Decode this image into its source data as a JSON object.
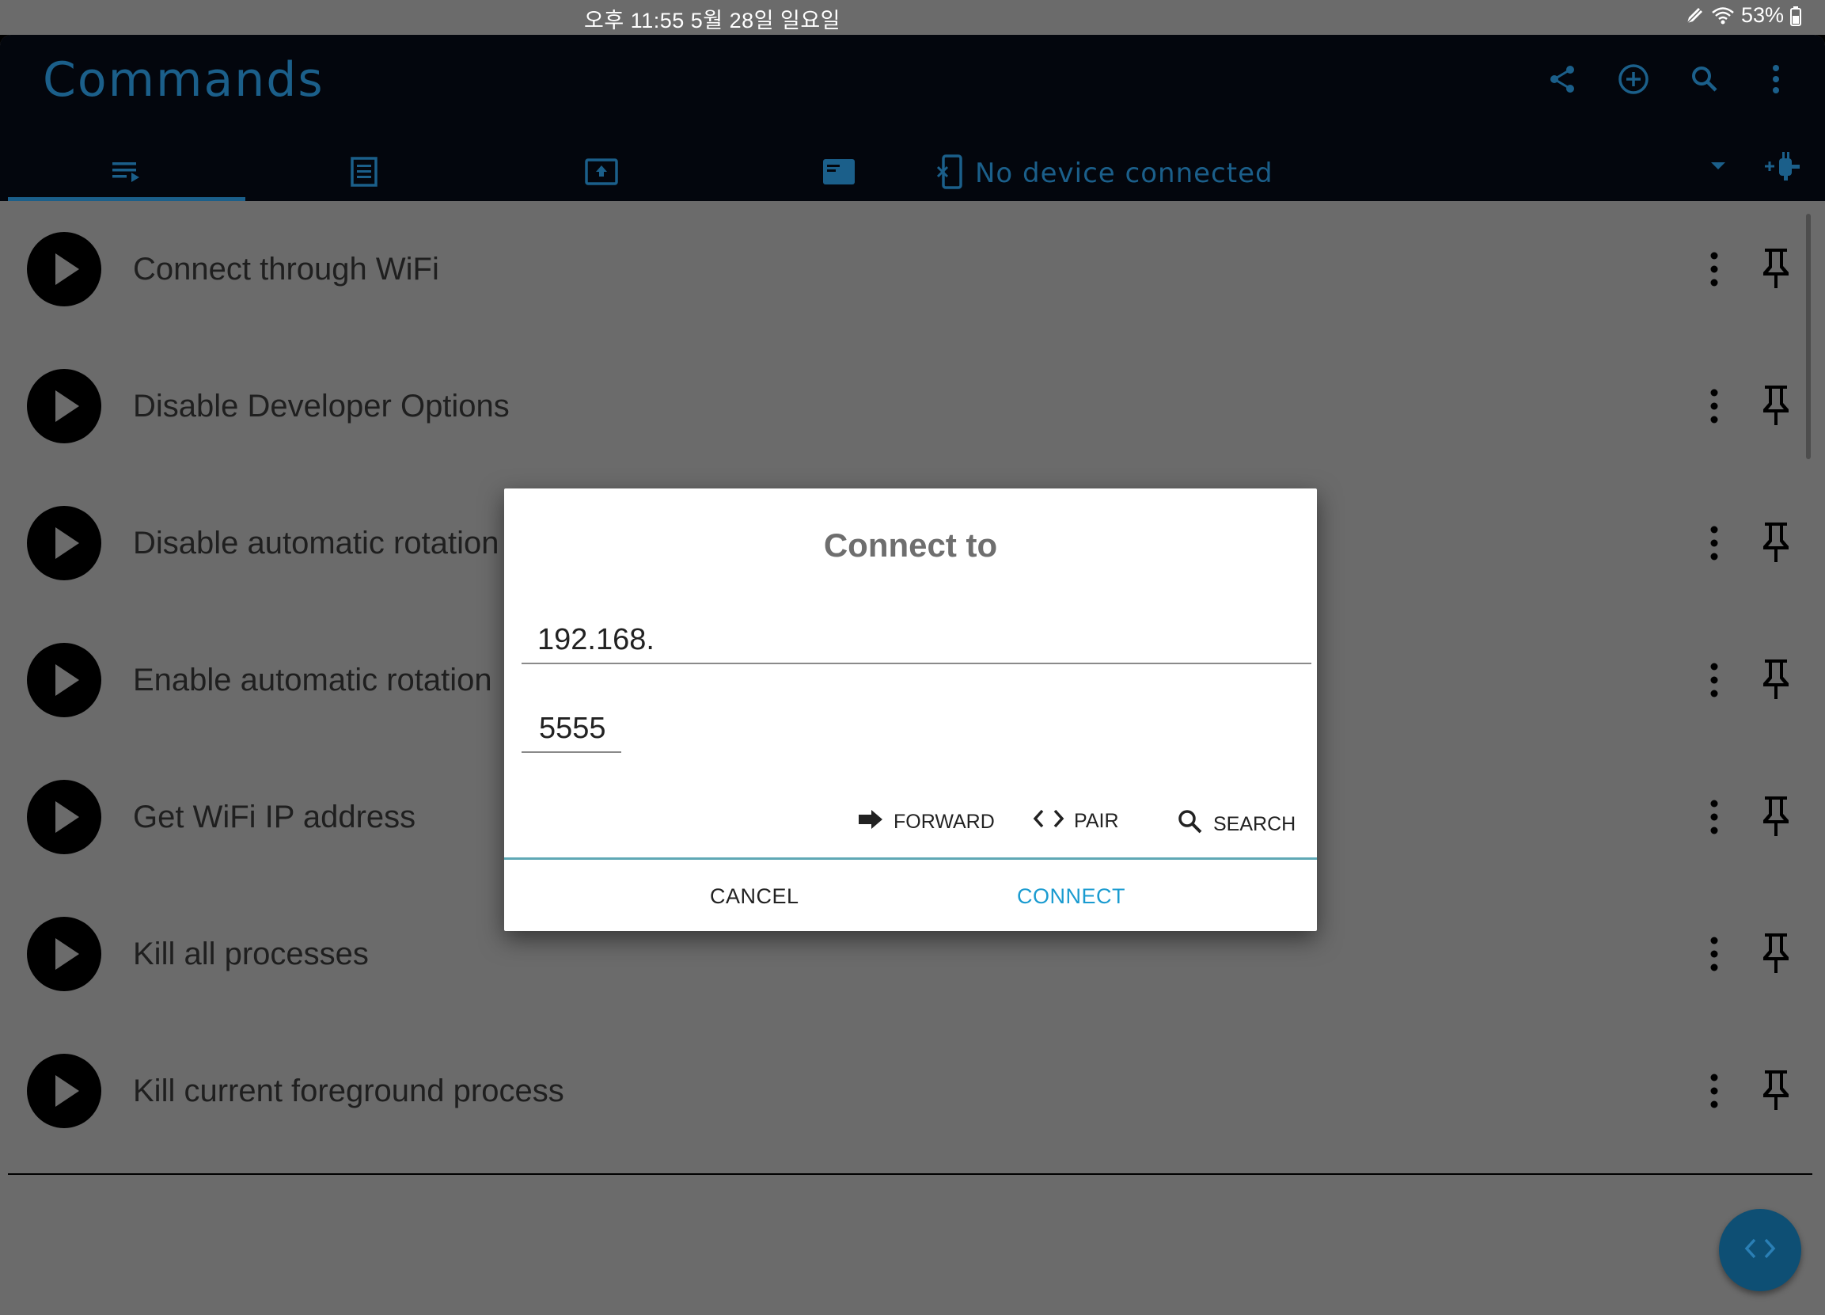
{
  "status_bar": {
    "time_date": "오후 11:55   5월 28일 일요일",
    "battery": "53%"
  },
  "app": {
    "title": "Commands",
    "actions": [
      "share-icon",
      "add-circle-icon",
      "search-icon",
      "more-vert-icon"
    ],
    "tabs": [
      "commands-list-icon",
      "notes-icon",
      "upload-screen-icon",
      "window-icon"
    ],
    "device_status": "No device connected"
  },
  "commands": [
    {
      "label": "Connect through WiFi"
    },
    {
      "label": "Disable Developer Options"
    },
    {
      "label": "Disable automatic rotation"
    },
    {
      "label": "Enable automatic rotation"
    },
    {
      "label": "Get WiFi IP address"
    },
    {
      "label": "Kill all processes"
    },
    {
      "label": "Kill current foreground process"
    }
  ],
  "dialog": {
    "title": "Connect to",
    "ip_value": "192.168.",
    "port_value": "5555",
    "forward_label": "FORWARD",
    "pair_label": "PAIR",
    "search_label": "SEARCH",
    "cancel_label": "CANCEL",
    "connect_label": "CONNECT"
  },
  "colors": {
    "accent": "#1b5f8a",
    "connect": "#1a9bd0",
    "appbar": "#03060d",
    "scrim_bg": "#6b6b6b"
  }
}
